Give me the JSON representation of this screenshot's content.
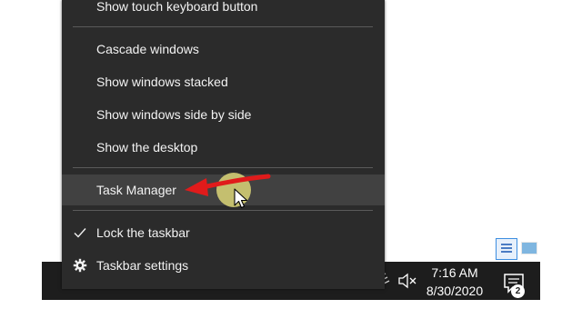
{
  "menu": {
    "items": [
      {
        "label": "Show touch keyboard button"
      },
      {
        "label": "Cascade windows"
      },
      {
        "label": "Show windows stacked"
      },
      {
        "label": "Show windows side by side"
      },
      {
        "label": "Show the desktop"
      },
      {
        "label": "Task Manager",
        "highlighted": true
      },
      {
        "label": "Lock the taskbar",
        "checked": true,
        "icon": "checkmark-icon"
      },
      {
        "label": "Taskbar settings",
        "icon": "gear-icon"
      }
    ]
  },
  "taskbar": {
    "clock": {
      "time": "7:16 AM",
      "date": "8/30/2020"
    },
    "notification_count": "2",
    "icons": [
      "wifi-icon",
      "speaker-muted-icon",
      "notification-center-icon"
    ],
    "color": "#1d1d1d"
  },
  "tray_overflow": {
    "icons": [
      "tray-flag-icon",
      "tray-image-icon"
    ]
  },
  "colors": {
    "menu_bg": "#2b2b2b",
    "menu_hover": "#414141",
    "annotation_arrow": "#e01b1b",
    "cursor_halo": "#dcd678"
  }
}
